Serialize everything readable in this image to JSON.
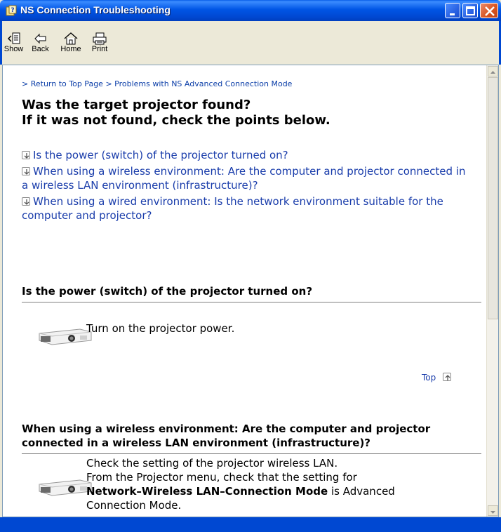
{
  "window": {
    "title": "NS Connection Troubleshooting"
  },
  "toolbar": {
    "show_label": "Show",
    "back_label": "Back",
    "home_label": "Home",
    "print_label": "Print"
  },
  "breadcrumb": {
    "return_link": "> Return to Top Page",
    "separator": ">",
    "current_link": "Problems with NS Advanced Connection Mode"
  },
  "heading": {
    "line1": "Was the target projector found?",
    "line2": "If it was not found, check the points below."
  },
  "links": [
    "Is the power (switch) of the projector turned on?",
    "When using a wireless environment: Are the computer and projector connected in a wireless LAN environment (infrastructure)?",
    "When using a wired environment: Is the network environment suitable for the computer and projector?"
  ],
  "section1": {
    "title": "Is the power (switch) of the projector turned on?",
    "text": "Turn on the projector power."
  },
  "top_link": "Top",
  "section2": {
    "title": "When using a wireless environment: Are the computer and projector connected in a wireless LAN environment (infrastructure)?",
    "line1": "Check the setting of the projector wireless LAN.",
    "line2": "From the Projector menu, check that the setting for",
    "bold": "Network–Wireless LAN–Connection Mode",
    "line3_rest": " is Advanced",
    "line4": "Connection Mode."
  },
  "colors": {
    "title_bar": "#0055e5",
    "link": "#1a3dab",
    "close_button": "#d9531e"
  },
  "icons": [
    "help-icon",
    "show-icon",
    "back-icon",
    "home-icon",
    "print-icon",
    "minimize-icon",
    "maximize-icon",
    "close-icon",
    "down-arrow-icon",
    "up-arrow-icon",
    "projector-image"
  ]
}
